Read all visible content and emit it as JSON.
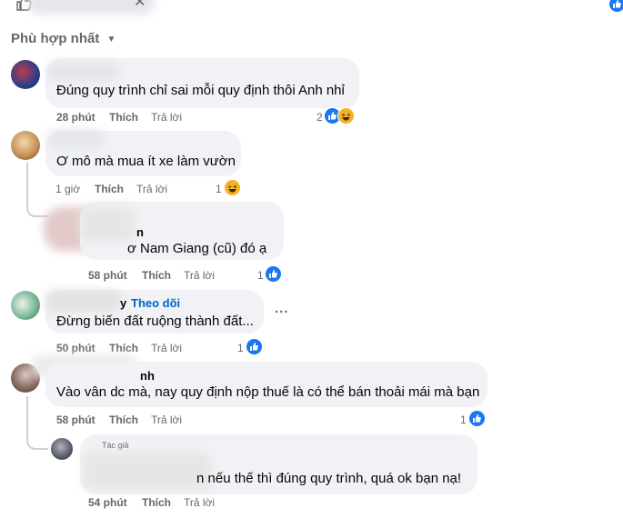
{
  "sort": {
    "label": "Phù hợp nhất"
  },
  "comments": [
    {
      "name": "",
      "text": "Đúng quy trình chỉ sai mỗi quy định thôi Anh nhỉ",
      "time": "28 phút",
      "like": "Thích",
      "reply": "Trả lời",
      "reaction_count": "2",
      "reactions": [
        "like",
        "haha"
      ]
    },
    {
      "name": "",
      "text": "Ơ mô mà mua ít xe làm vườn",
      "time": "1 giờ",
      "like": "Thích",
      "reply": "Trả lời",
      "reaction_count": "1",
      "reactions": [
        "haha"
      ]
    },
    {
      "name": "n",
      "text": "ơ Nam Giang (cũ) đó ạ",
      "time": "58 phút",
      "like": "Thích",
      "reply": "Trả lời",
      "reaction_count": "1",
      "reactions": [
        "like"
      ]
    },
    {
      "name": "y",
      "follow": "Theo dõi",
      "text": "Đừng biến đất ruộng thành đất...",
      "more": "...",
      "time": "50 phút",
      "like": "Thích",
      "reply": "Trả lời",
      "reaction_count": "1",
      "reactions": [
        "like"
      ]
    },
    {
      "name": "nh",
      "text": "Vào vân dc mà, nay quy định nộp thuế là có thể bán thoải mái mà bạn",
      "time": "58 phút",
      "like": "Thích",
      "reply": "Trả lời",
      "reaction_count": "1",
      "reactions": [
        "like"
      ]
    },
    {
      "badge": "Tác giả",
      "text": "n nếu thế thì đúng quy trình, quá ok bạn nạ!",
      "time": "54 phút",
      "like": "Thích",
      "reply": "Trả lời"
    }
  ],
  "colors": {
    "like": "#1877f2",
    "haha": "#f7b125",
    "meta": "#65676b",
    "bubble": "#f0f2f5",
    "follow": "#0064d1"
  }
}
